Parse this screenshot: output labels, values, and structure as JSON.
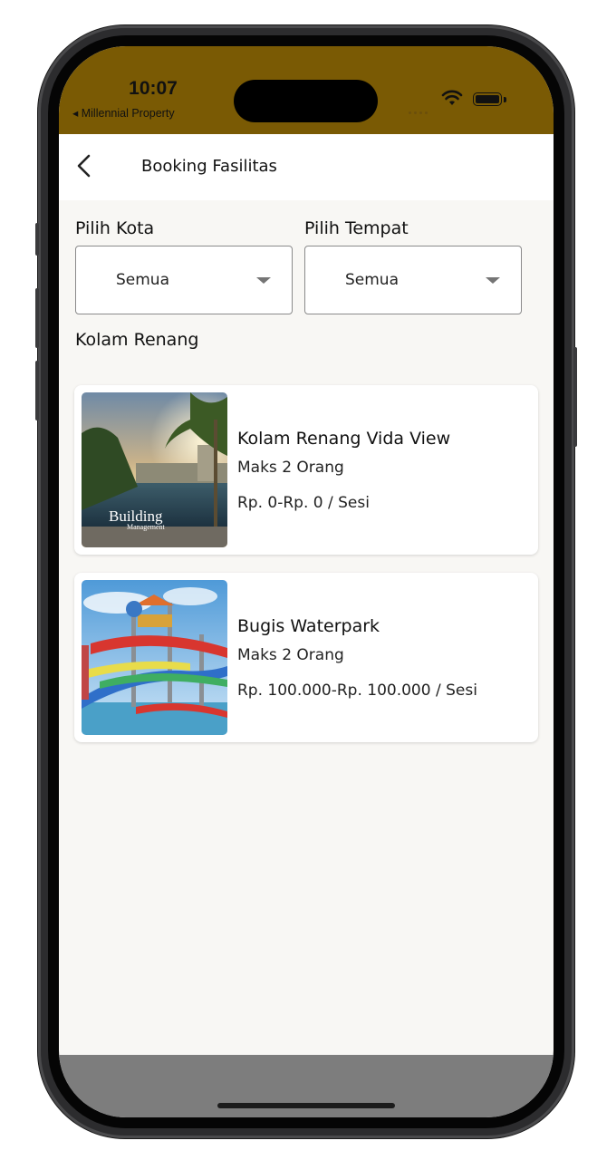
{
  "status_bar": {
    "time": "10:07",
    "back_app": "◂ Millennial Property",
    "icons": [
      "cellular-icon",
      "wifi-icon",
      "battery-icon"
    ]
  },
  "header": {
    "back_icon": "chevron-left-icon",
    "title": "Booking Fasilitas"
  },
  "filters": {
    "city": {
      "label": "Pilih Kota",
      "value": "Semua"
    },
    "place": {
      "label": "Pilih Tempat",
      "value": "Semua"
    }
  },
  "section": {
    "title": "Kolam Renang"
  },
  "facilities": [
    {
      "name": "Kolam Renang Vida View",
      "capacity": "Maks 2 Orang",
      "price": "Rp. 0-Rp. 0 / Sesi",
      "image_caption": "Building Management",
      "image": "rooftop-pool-photo"
    },
    {
      "name": "Bugis Waterpark",
      "capacity": "Maks 2 Orang",
      "price": "Rp. 100.000-Rp. 100.000 / Sesi",
      "image": "waterpark-slides-photo"
    }
  ],
  "colors": {
    "status_bar": "#7a5a04",
    "background": "#f8f7f4",
    "card": "#ffffff",
    "nav_bar": "#7d7d7d"
  }
}
